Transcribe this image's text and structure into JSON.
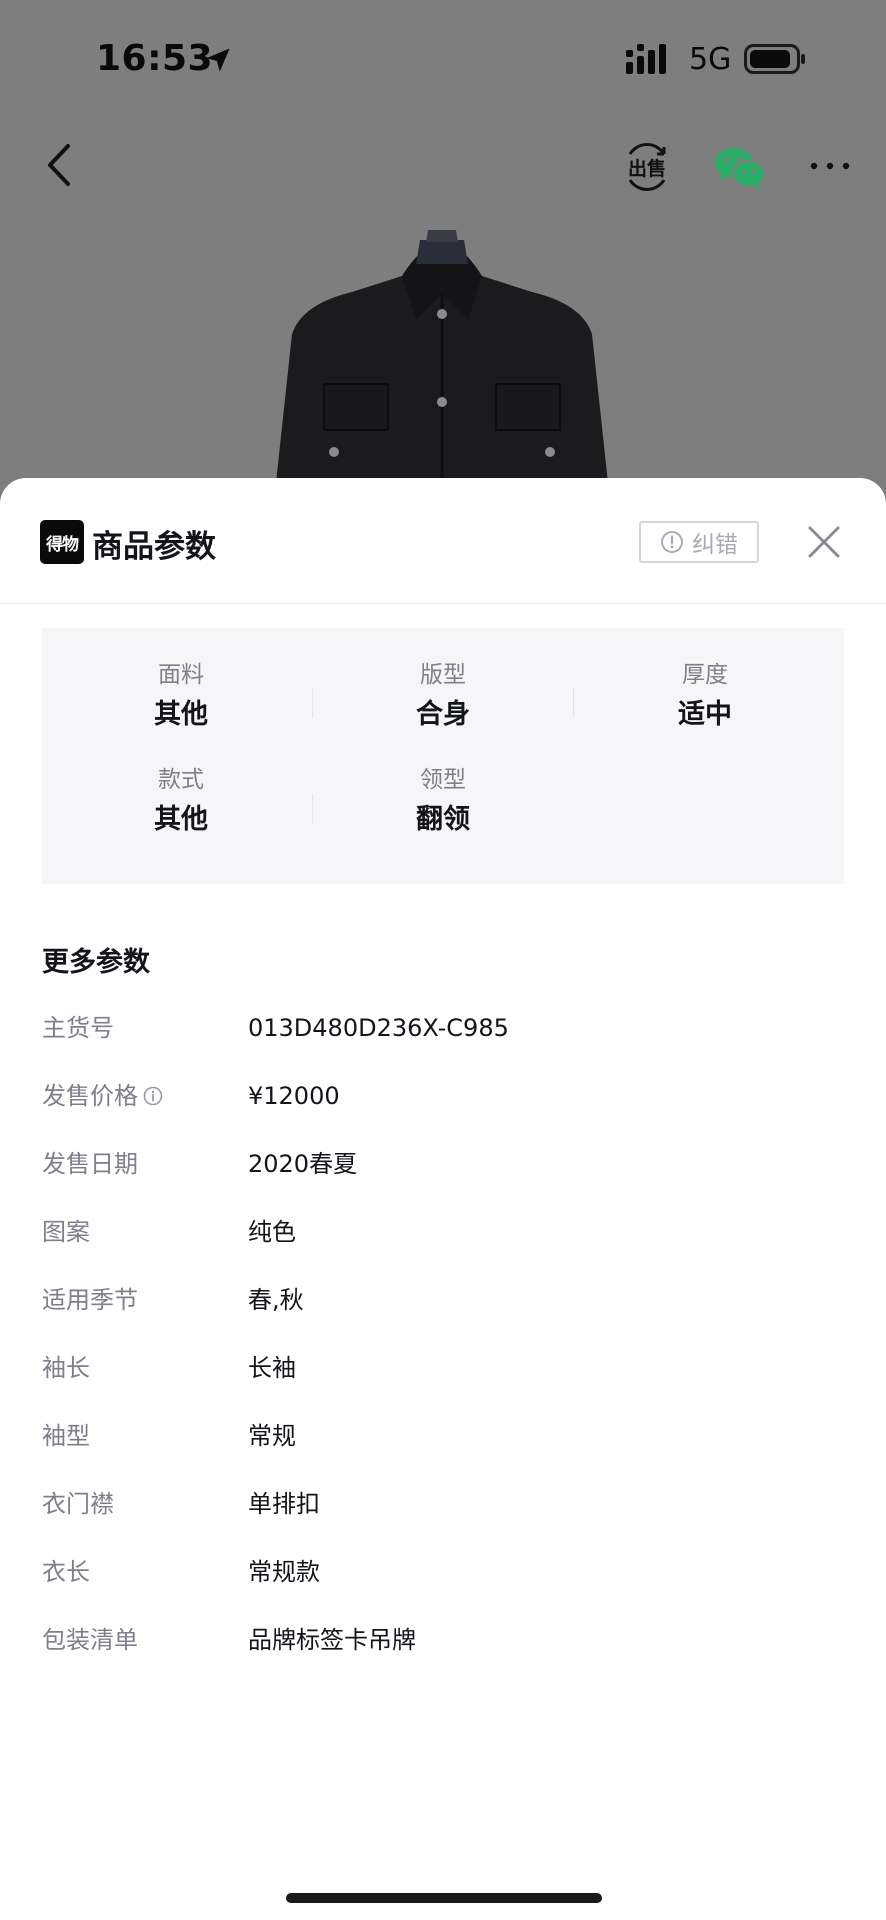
{
  "status_bar": {
    "time": "16:53",
    "network": "5G"
  },
  "nav": {
    "back_icon": "chevron-left-icon",
    "sell_icon": "sell-icon",
    "sell_label": "出售",
    "share_icon": "wechat-icon",
    "more_icon": "more-horizontal-icon"
  },
  "sheet": {
    "brand_logo": "得物",
    "title": "商品参数",
    "report_label": "纠错",
    "close_icon": "close-icon"
  },
  "basic_params": [
    {
      "label": "面料",
      "value": "其他"
    },
    {
      "label": "版型",
      "value": "合身"
    },
    {
      "label": "厚度",
      "value": "适中"
    },
    {
      "label": "款式",
      "value": "其他"
    },
    {
      "label": "领型",
      "value": "翻领"
    }
  ],
  "more_params": {
    "title": "更多参数",
    "items": [
      {
        "label": "主货号",
        "value": "013D480D236X-C985"
      },
      {
        "label": "发售价格",
        "value": "¥12000",
        "has_info": true
      },
      {
        "label": "发售日期",
        "value": "2020春夏"
      },
      {
        "label": "图案",
        "value": "纯色"
      },
      {
        "label": "适用季节",
        "value": "春,秋"
      },
      {
        "label": "袖长",
        "value": "长袖"
      },
      {
        "label": "袖型",
        "value": "常规"
      },
      {
        "label": "衣门襟",
        "value": "单排扣"
      },
      {
        "label": "衣长",
        "value": "常规款"
      },
      {
        "label": "包装清单",
        "value": "品牌标签卡吊牌"
      }
    ]
  },
  "colors": {
    "backdrop": "#7e7e7e",
    "sheet": "#ffffff",
    "params_bg": "#f6f6f9",
    "label_gray": "#7f7f8b",
    "text": "#14151a",
    "wechat_green": "#2aae67"
  }
}
